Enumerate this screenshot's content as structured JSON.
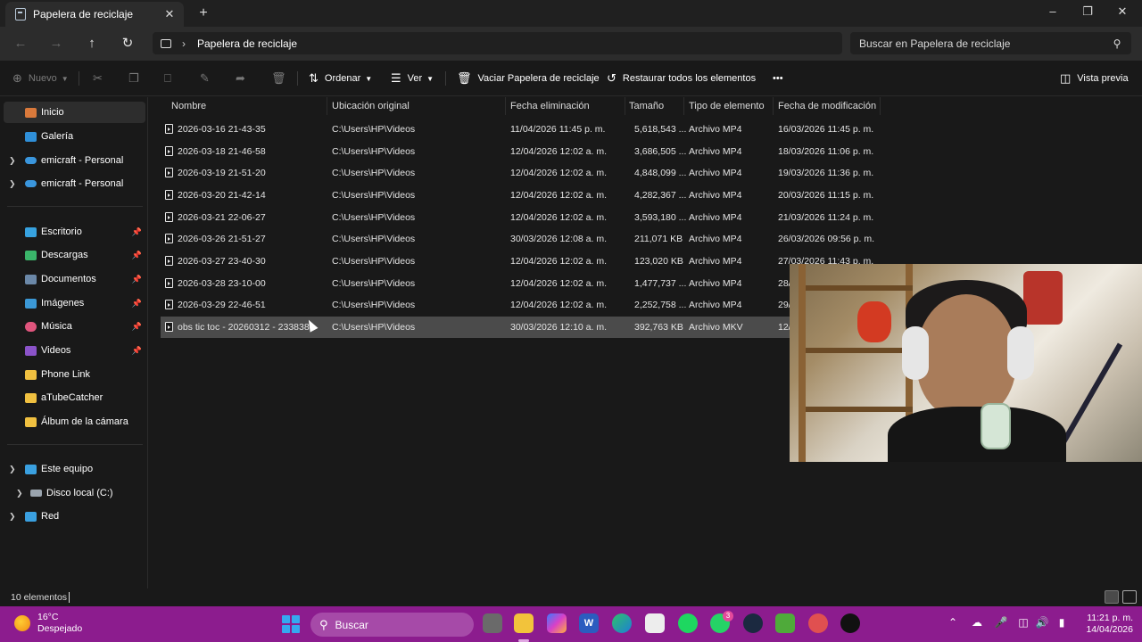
{
  "window": {
    "tab_title": "Papelera de reciclaje",
    "tab_close": "✕",
    "new_tab": "+"
  },
  "address": {
    "path": "Papelera de reciclaje",
    "search_placeholder": "Buscar en Papelera de reciclaje"
  },
  "toolbar": {
    "new_label": "Nuevo",
    "sort_label": "Ordenar",
    "view_label": "Ver",
    "empty_label": "Vaciar Papelera de reciclaje",
    "restore_all_label": "Restaurar todos los elementos",
    "more_label": "•••",
    "preview_label": "Vista previa"
  },
  "sidebar": {
    "items": [
      {
        "label": "Inicio",
        "icon": "home-icon",
        "color": "#d9793b"
      },
      {
        "label": "Galería",
        "icon": "gallery-icon",
        "color": "#2f8fd8"
      },
      {
        "label": "emicraft - Personal",
        "icon": "onedrive-icon",
        "color": "#3a96dd"
      },
      {
        "label": "emicraft - Personal",
        "icon": "onedrive-icon",
        "color": "#3a96dd"
      },
      {
        "label": "Escritorio",
        "icon": "desktop-icon",
        "color": "#37a2e0"
      },
      {
        "label": "Descargas",
        "icon": "download-icon",
        "color": "#3ab56a"
      },
      {
        "label": "Documentos",
        "icon": "document-icon",
        "color": "#6b88a8"
      },
      {
        "label": "Imágenes",
        "icon": "pictures-icon",
        "color": "#3b98d6"
      },
      {
        "label": "Música",
        "icon": "music-icon",
        "color": "#e0557d"
      },
      {
        "label": "Videos",
        "icon": "video-icon",
        "color": "#8b53c9"
      },
      {
        "label": "Phone Link",
        "icon": "folder-icon",
        "color": "#f0c040"
      },
      {
        "label": "aTubeCatcher",
        "icon": "folder-icon",
        "color": "#f0c040"
      },
      {
        "label": "Álbum de la cámara",
        "icon": "folder-icon",
        "color": "#f0c040"
      },
      {
        "label": "Este equipo",
        "icon": "computer-icon",
        "color": "#3aa0e0"
      },
      {
        "label": "Disco local (C:)",
        "icon": "drive-icon",
        "color": "#9aa4ae"
      },
      {
        "label": "Red",
        "icon": "network-icon",
        "color": "#3aa0e0"
      }
    ]
  },
  "columns": [
    "Nombre",
    "Ubicación original",
    "Fecha eliminación",
    "Tamaño",
    "Tipo de elemento",
    "Fecha de modificación"
  ],
  "files": [
    {
      "name": "2026-03-16 21-43-35",
      "location": "C:\\Users\\HP\\Videos",
      "deleted": "11/04/2026 11:45 p. m.",
      "size": "5,618,543 ...",
      "type": "Archivo MP4",
      "modified": "16/03/2026 11:45 p. m."
    },
    {
      "name": "2026-03-18 21-46-58",
      "location": "C:\\Users\\HP\\Videos",
      "deleted": "12/04/2026 12:02 a. m.",
      "size": "3,686,505 ...",
      "type": "Archivo MP4",
      "modified": "18/03/2026 11:06 p. m."
    },
    {
      "name": "2026-03-19 21-51-20",
      "location": "C:\\Users\\HP\\Videos",
      "deleted": "12/04/2026 12:02 a. m.",
      "size": "4,848,099 ...",
      "type": "Archivo MP4",
      "modified": "19/03/2026 11:36 p. m."
    },
    {
      "name": "2026-03-20 21-42-14",
      "location": "C:\\Users\\HP\\Videos",
      "deleted": "12/04/2026 12:02 a. m.",
      "size": "4,282,367 ...",
      "type": "Archivo MP4",
      "modified": "20/03/2026 11:15 p. m."
    },
    {
      "name": "2026-03-21 22-06-27",
      "location": "C:\\Users\\HP\\Videos",
      "deleted": "12/04/2026 12:02 a. m.",
      "size": "3,593,180 ...",
      "type": "Archivo MP4",
      "modified": "21/03/2026 11:24 p. m."
    },
    {
      "name": "2026-03-26 21-51-27",
      "location": "C:\\Users\\HP\\Videos",
      "deleted": "30/03/2026 12:08 a. m.",
      "size": "211,071 KB",
      "type": "Archivo MP4",
      "modified": "26/03/2026 09:56 p. m."
    },
    {
      "name": "2026-03-27 23-40-30",
      "location": "C:\\Users\\HP\\Videos",
      "deleted": "12/04/2026 12:02 a. m.",
      "size": "123,020 KB",
      "type": "Archivo MP4",
      "modified": "27/03/2026 11:43 p. m."
    },
    {
      "name": "2026-03-28 23-10-00",
      "location": "C:\\Users\\HP\\Videos",
      "deleted": "12/04/2026 12:02 a. m.",
      "size": "1,477,737 ...",
      "type": "Archivo MP4",
      "modified": "28/"
    },
    {
      "name": "2026-03-29 22-46-51",
      "location": "C:\\Users\\HP\\Videos",
      "deleted": "12/04/2026 12:02 a. m.",
      "size": "2,252,758 ...",
      "type": "Archivo MP4",
      "modified": "29/"
    },
    {
      "name": "obs tic toc - 20260312 - 233838",
      "location": "C:\\Users\\HP\\Videos",
      "deleted": "30/03/2026 12:10 a. m.",
      "size": "392,763 KB",
      "type": "Archivo MKV",
      "modified": "12/"
    }
  ],
  "status": {
    "count": "10 elementos"
  },
  "taskbar": {
    "temperature": "16°C",
    "condition": "Despejado",
    "search_label": "Buscar",
    "whatsapp_badge": "3",
    "time": "11:21 p. m.",
    "date": "14/04/2026",
    "word_letter": "W"
  },
  "colors": {
    "accent": "#8c1c8e",
    "background": "#191919",
    "selected_row": "#4b4b4b"
  }
}
